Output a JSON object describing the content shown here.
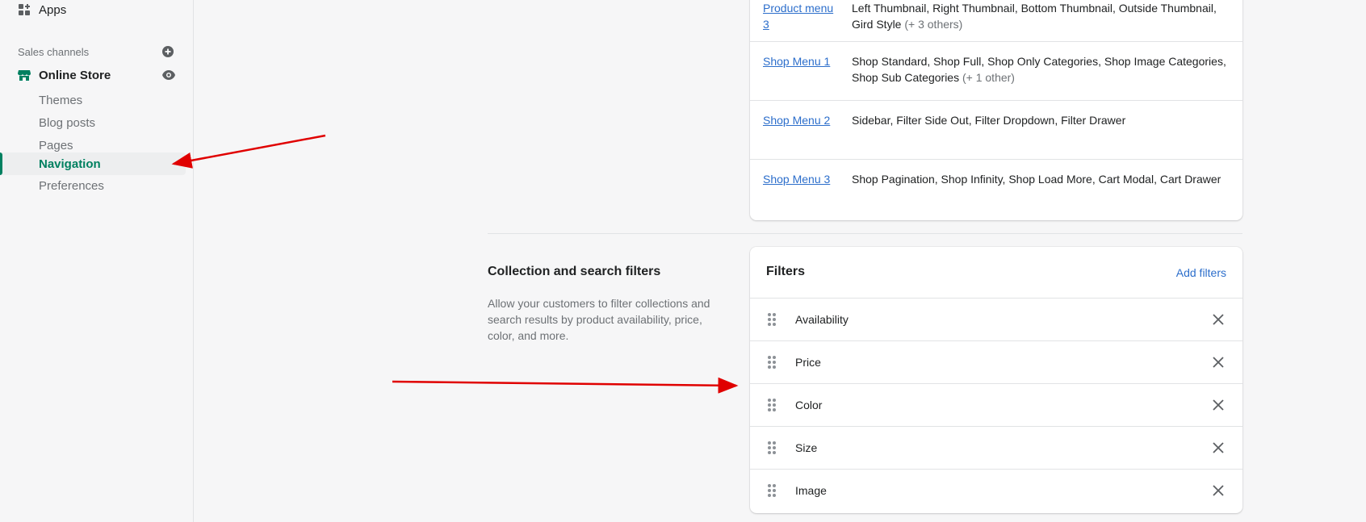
{
  "sidebar": {
    "apps_label": "Apps",
    "sales_channels_label": "Sales channels",
    "online_store_label": "Online Store",
    "sub_items": [
      {
        "label": "Themes"
      },
      {
        "label": "Blog posts"
      },
      {
        "label": "Pages"
      },
      {
        "label": "Navigation",
        "active": true
      },
      {
        "label": "Preferences"
      }
    ]
  },
  "menus": [
    {
      "link": "Product menu 3",
      "items": "Left Thumbnail, Right Thumbnail, Bottom Thumbnail, Outside Thumbnail, Gird Style",
      "more": "(+ 3 others)"
    },
    {
      "link": "Shop Menu 1",
      "items": "Shop Standard, Shop Full, Shop Only Categories, Shop Image Categories, Shop Sub Categories",
      "more": "(+ 1 other)"
    },
    {
      "link": "Shop Menu 2",
      "items": "Sidebar, Filter Side Out, Filter Dropdown, Filter Drawer",
      "more": ""
    },
    {
      "link": "Shop Menu 3",
      "items": "Shop Pagination, Shop Infinity, Shop Load More, Cart Modal, Cart Drawer",
      "more": ""
    }
  ],
  "filters_section": {
    "title": "Collection and search filters",
    "description": "Allow your customers to filter collections and search results by product availability, price, color, and more.",
    "card_title": "Filters",
    "add_label": "Add filters",
    "filters": [
      {
        "name": "Availability"
      },
      {
        "name": "Price"
      },
      {
        "name": "Color"
      },
      {
        "name": "Size"
      },
      {
        "name": "Image"
      }
    ]
  },
  "colors": {
    "accent_green": "#008060",
    "link_blue": "#2c6ecb",
    "annotation_red": "#e00000"
  }
}
